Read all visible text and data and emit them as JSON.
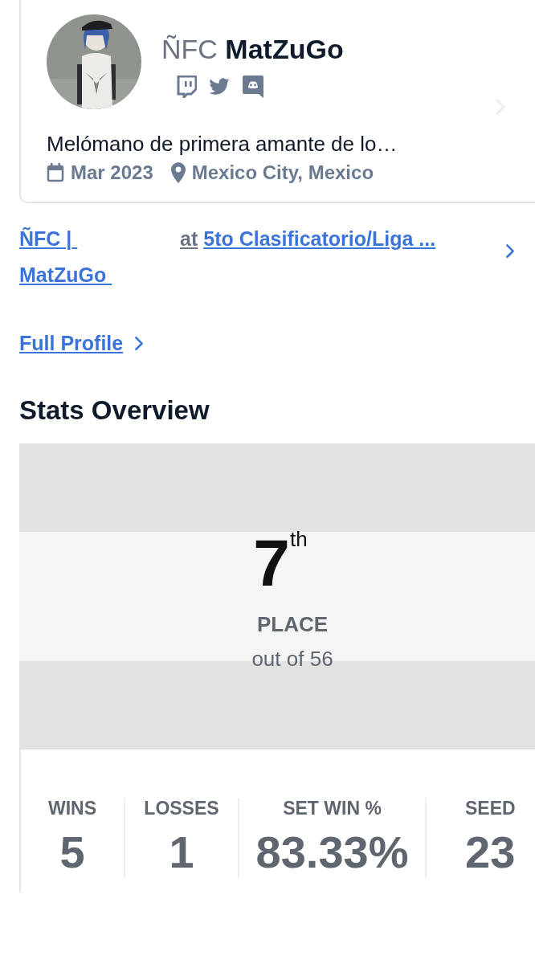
{
  "profile": {
    "prefix": "ÑFC",
    "name": "MatZuGo",
    "bio": "Melómano de primera amante de lo…",
    "joined": "Mar 2023",
    "location": "Mexico City, Mexico"
  },
  "event_link": {
    "player": "ÑFC | MatZuGo ",
    "at": "at",
    "event": "5to Clasificatorio/Liga ..."
  },
  "full_profile": "Full Profile",
  "stats_heading": "Stats Overview",
  "placement": {
    "place": "7",
    "suffix": "th",
    "label": "PLACE",
    "total": "out of 56"
  },
  "stats": [
    {
      "label": "WINS",
      "value": "5"
    },
    {
      "label": "LOSSES",
      "value": "1"
    },
    {
      "label": "SET WIN %",
      "value": "83.33%"
    },
    {
      "label": "SEED",
      "value": "23"
    }
  ]
}
